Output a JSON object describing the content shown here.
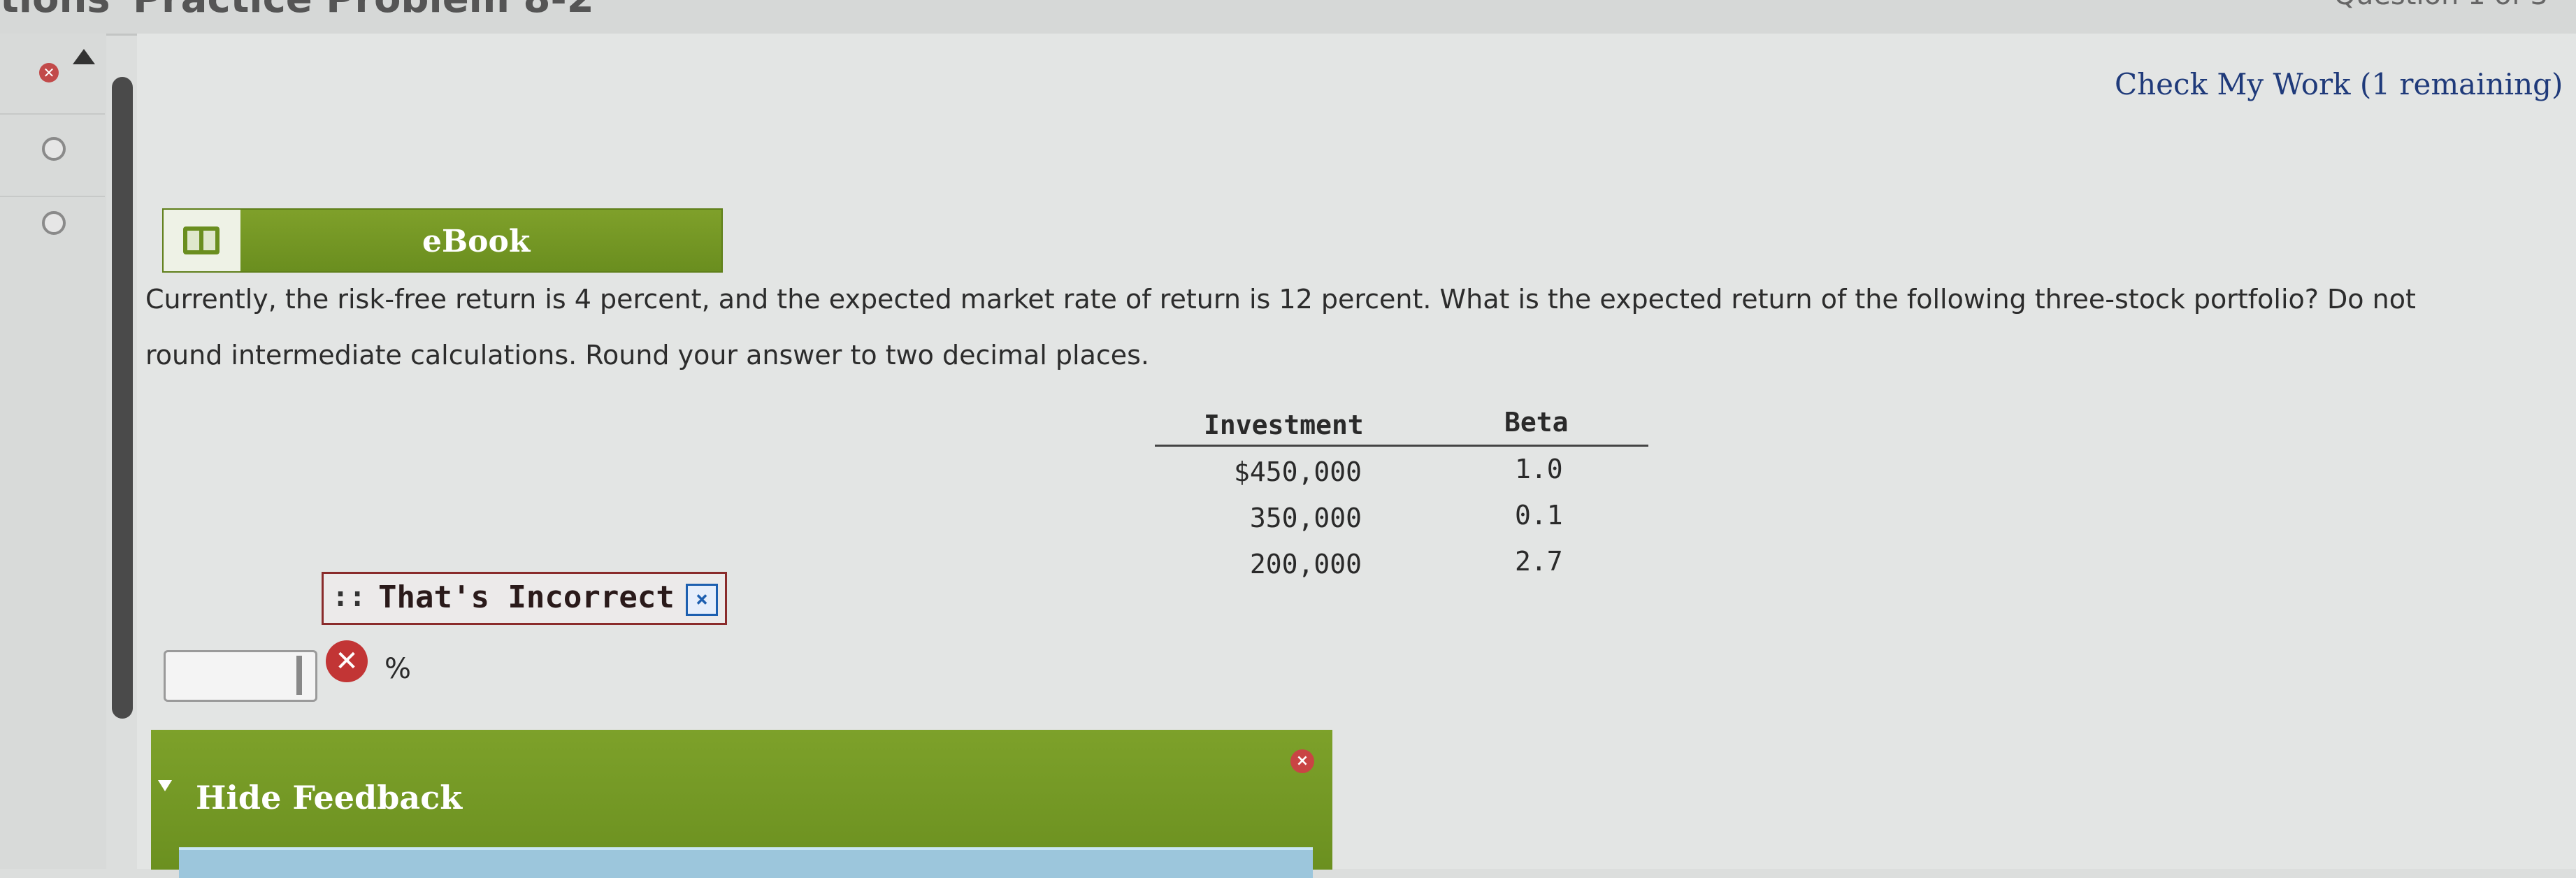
{
  "tabs": {
    "left": "tions",
    "center": "Practice Problem 8-2",
    "right": "Question 1 of 3"
  },
  "nav": {
    "scroll_up": "▲",
    "item_status_incorrect": "✕"
  },
  "header": {
    "check_work": "Check My Work (1 remaining)"
  },
  "ebook": {
    "label": "eBook"
  },
  "question": {
    "line1": "Currently, the risk-free return is 4 percent, and the expected market rate of return is 12 percent. What is the expected return of the following three-stock portfolio? Do not",
    "line2": "round intermediate calculations. Round your answer to two decimal places."
  },
  "table": {
    "headers": [
      "Investment",
      "Beta"
    ],
    "rows": [
      [
        "$450,000",
        "1.0"
      ],
      [
        "350,000",
        "0.1"
      ],
      [
        "200,000",
        "2.7"
      ]
    ]
  },
  "feedback_badge": {
    "grip": "::",
    "text": "That's Incorrect",
    "close": "×"
  },
  "answer": {
    "value": "",
    "status_icon": "✕",
    "unit": "%"
  },
  "feedback": {
    "label": "Hide Feedback",
    "close": "×"
  },
  "colors": {
    "accent_green": "#6a8e1f",
    "link_blue": "#1f3a7a",
    "error_red": "#c23535"
  }
}
